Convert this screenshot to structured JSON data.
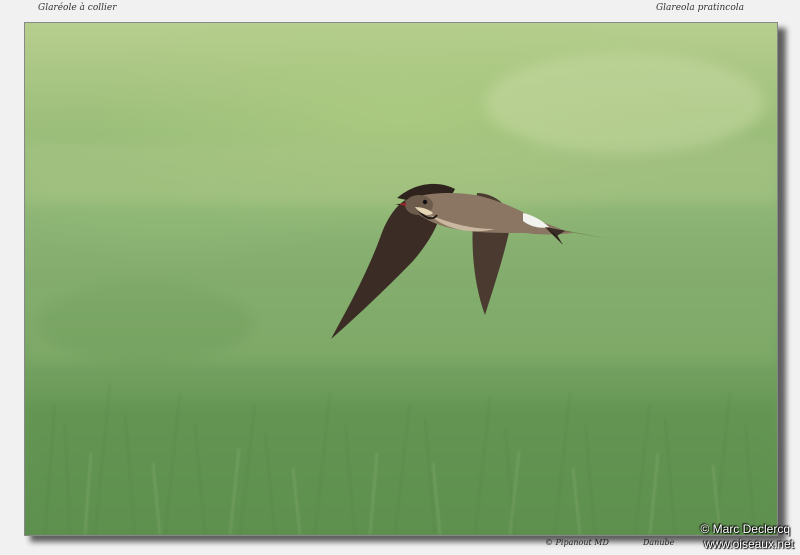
{
  "captions": {
    "common_name": "Glaréole à collier",
    "latin_name": "Glareola pratincola",
    "photographer": "© Pipanout MD",
    "location": "Danube"
  },
  "watermark": {
    "copyright": "© Marc Declercq",
    "site": "www.oiseaux.net"
  },
  "photo": {
    "subject": "bird-in-flight",
    "background_colors": [
      "#b7ce8e",
      "#8fb676",
      "#5d8e4e"
    ]
  }
}
